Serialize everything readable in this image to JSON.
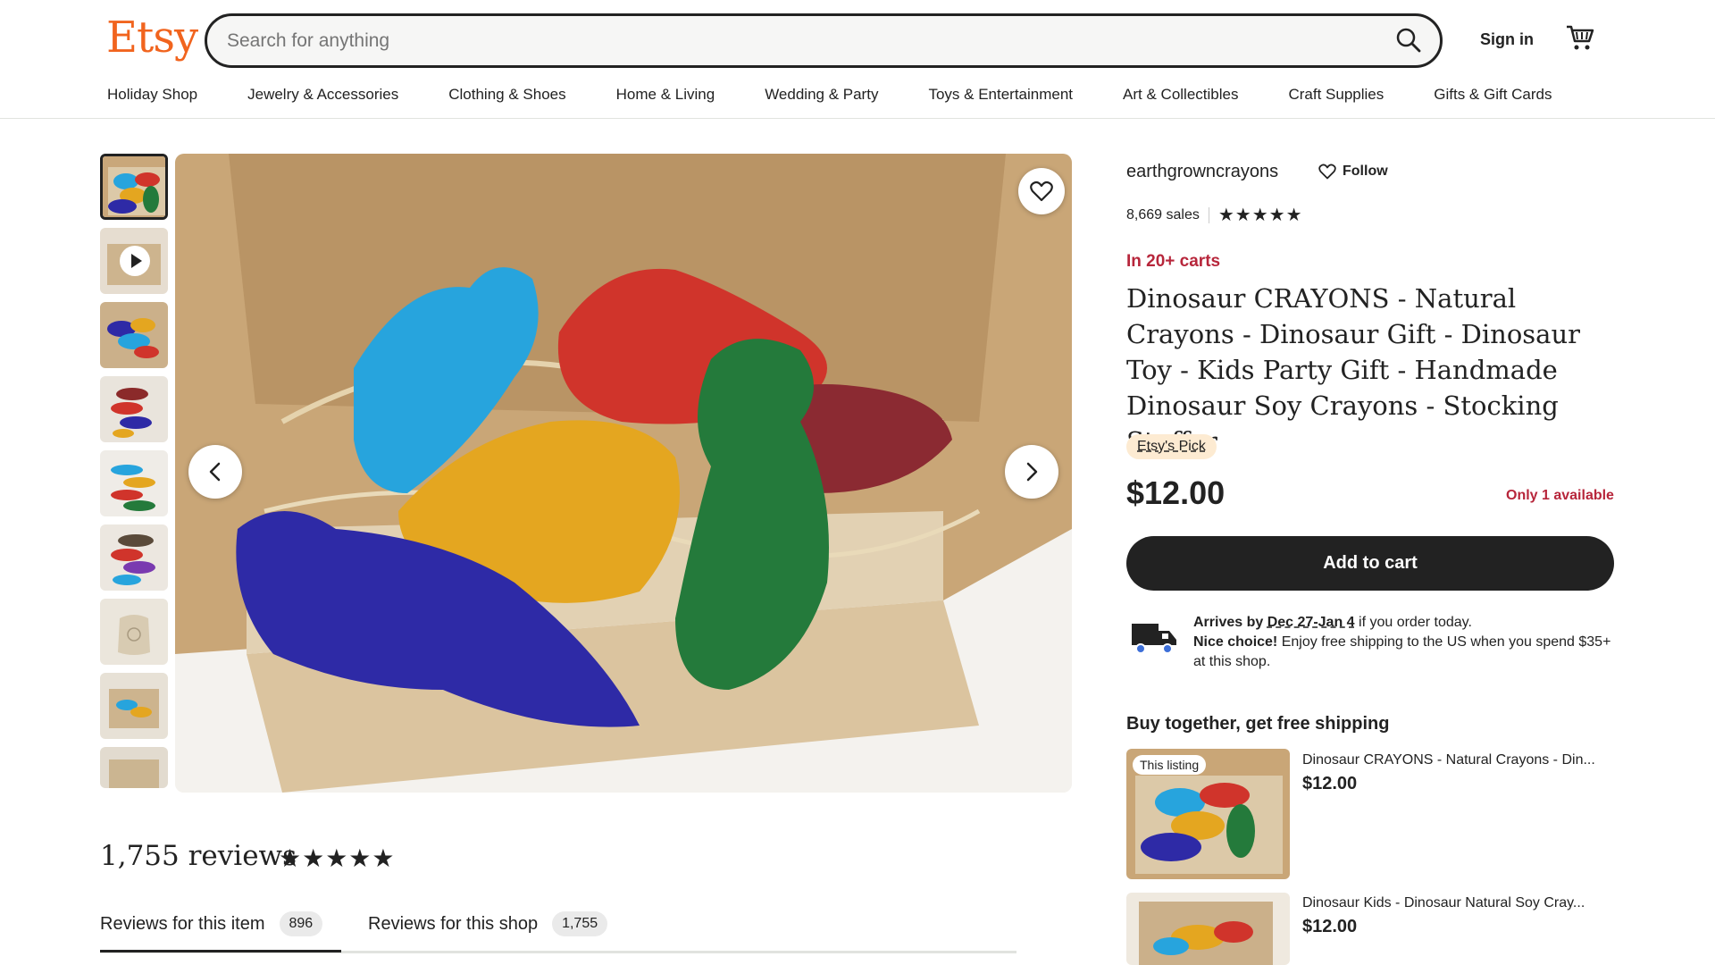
{
  "header": {
    "logo": "Etsy",
    "search_placeholder": "Search for anything",
    "sign_in": "Sign in",
    "nav": [
      "Holiday Shop",
      "Jewelry & Accessories",
      "Clothing & Shoes",
      "Home & Living",
      "Wedding & Party",
      "Toys & Entertainment",
      "Art & Collectibles",
      "Craft Supplies",
      "Gifts & Gift Cards"
    ]
  },
  "gallery": {
    "thumbnails_count": 9,
    "active_index": 0,
    "video_thumb_index": 1
  },
  "reviews": {
    "title": "1,755 reviews",
    "stars": "★★★★★",
    "tab_item": "Reviews for this item",
    "tab_item_count": "896",
    "tab_shop": "Reviews for this shop",
    "tab_shop_count": "1,755"
  },
  "product": {
    "shop_name": "earthgrowncrayons",
    "follow": "Follow",
    "sales": "8,669 sales",
    "shop_stars": "★★★★★",
    "in_carts": "In 20+ carts",
    "title": "Dinosaur CRAYONS - Natural Crayons - Dinosaur Gift - Dinosaur Toy - Kids Party Gift - Handmade Dinosaur Soy Crayons - Stocking Stuffer",
    "badge": "Etsy's Pick",
    "price": "$12.00",
    "availability": "Only 1 available",
    "add_to_cart": "Add to cart"
  },
  "shipping": {
    "arrives_label": "Arrives by",
    "arrives_date": "Dec 27-Jan 4",
    "arrives_suffix": " if you order today.",
    "nice_choice": "Nice choice!",
    "free_shipping_text": " Enjoy free shipping to the US when you spend $35+ at this shop."
  },
  "bundle": {
    "heading": "Buy together, get free shipping",
    "this_listing": "This listing",
    "items": [
      {
        "name": "Dinosaur CRAYONS - Natural Crayons - Din...",
        "price": "$12.00"
      },
      {
        "name": "Dinosaur Kids - Dinosaur Natural Soy Cray...",
        "price": "$12.00"
      }
    ]
  },
  "colors": {
    "brand": "#f1641e",
    "alert_red": "#b7263b",
    "dark": "#222222",
    "badge_bg": "#fdebd2"
  }
}
